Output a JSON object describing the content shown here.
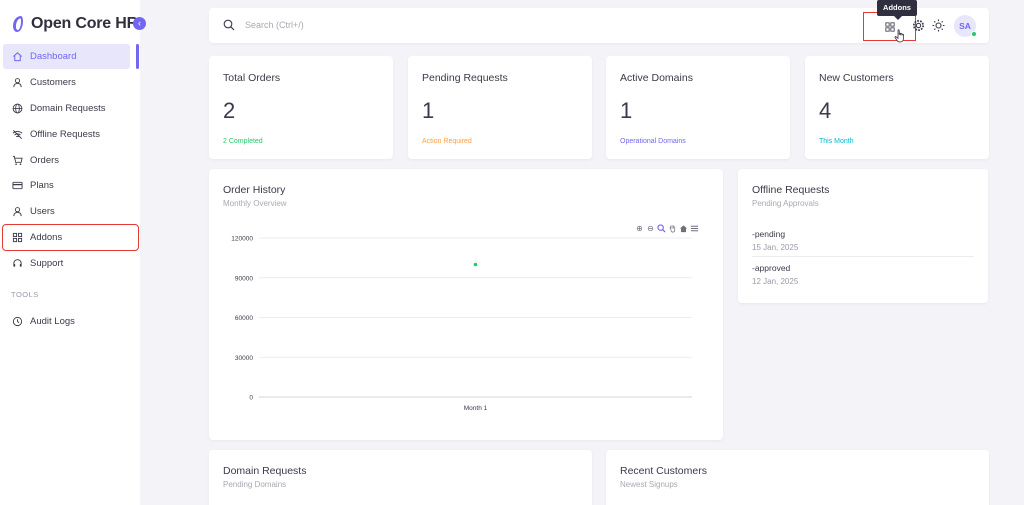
{
  "app": {
    "name": "Open Core HR"
  },
  "sidebar": {
    "items": [
      {
        "label": "Dashboard",
        "icon": "home-icon"
      },
      {
        "label": "Customers",
        "icon": "user-icon"
      },
      {
        "label": "Domain Requests",
        "icon": "globe-icon"
      },
      {
        "label": "Offline Requests",
        "icon": "wifi-off-icon"
      },
      {
        "label": "Orders",
        "icon": "cart-icon"
      },
      {
        "label": "Plans",
        "icon": "credit-card-icon"
      },
      {
        "label": "Users",
        "icon": "user-icon"
      },
      {
        "label": "Addons",
        "icon": "grid-icon"
      },
      {
        "label": "Support",
        "icon": "headset-icon"
      }
    ],
    "section_label": "TOOLS",
    "tools": [
      {
        "label": "Audit Logs",
        "icon": "history-icon"
      }
    ]
  },
  "topbar": {
    "search_placeholder": "Search (Ctrl+/)",
    "tooltip": "Addons",
    "avatar_initials": "SA"
  },
  "stats": [
    {
      "label": "Total Orders",
      "value": "2",
      "sub": "2 Completed",
      "color": "#28c76f"
    },
    {
      "label": "Pending Requests",
      "value": "1",
      "sub": "Action Required",
      "color": "#ff9f43"
    },
    {
      "label": "Active Domains",
      "value": "1",
      "sub": "Operational Domains",
      "color": "#7367f0"
    },
    {
      "label": "New Customers",
      "value": "4",
      "sub": "This Month",
      "color": "#00bad1"
    }
  ],
  "order_history": {
    "title": "Order History",
    "subtitle": "Monthly Overview"
  },
  "chart_data": {
    "type": "scatter",
    "title": "",
    "xlabel": "",
    "ylabel": "",
    "categories": [
      "Month 1"
    ],
    "series": [
      {
        "values": [
          100000
        ],
        "color": "#28c76f"
      }
    ],
    "ylim": [
      0,
      120000
    ],
    "yticks": [
      "120000",
      "90000",
      "60000",
      "30000",
      "0"
    ],
    "grid": true
  },
  "offline_requests": {
    "title": "Offline Requests",
    "subtitle": "Pending Approvals",
    "items": [
      {
        "status": "-pending",
        "date": "15 Jan, 2025"
      },
      {
        "status": "-approved",
        "date": "12 Jan, 2025"
      }
    ]
  },
  "domain_requests": {
    "title": "Domain Requests",
    "subtitle": "Pending Domains"
  },
  "recent_customers": {
    "title": "Recent Customers",
    "subtitle": "Newest Signups"
  },
  "colors": {
    "accent": "#7367f0",
    "highlight": "#e53935"
  }
}
